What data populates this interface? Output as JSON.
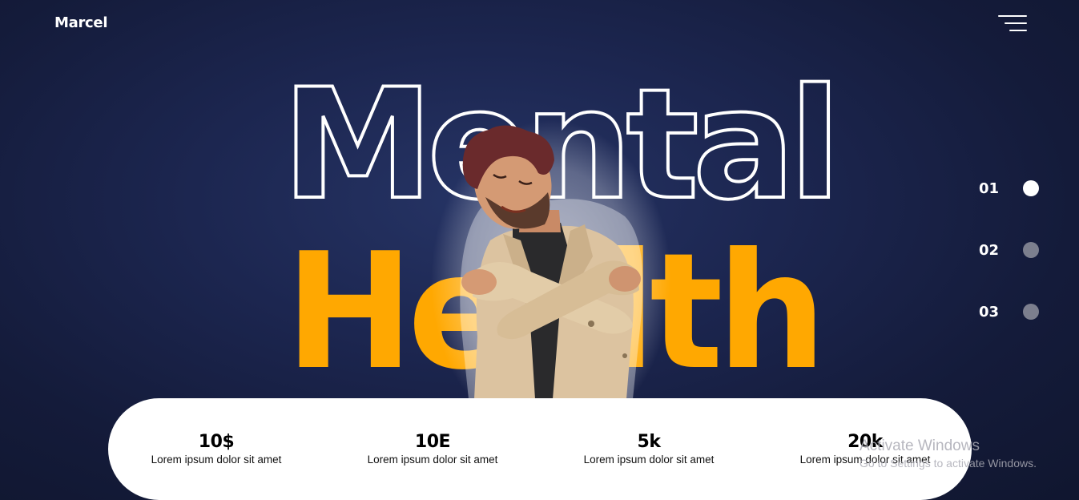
{
  "header": {
    "logo": "Marcel",
    "menu_icon": "hamburger-menu-icon"
  },
  "hero": {
    "title_line1": "Mental",
    "title_line2": "Health",
    "image": "man-hugging-himself-photo"
  },
  "slides": [
    {
      "label": "01",
      "active": true
    },
    {
      "label": "02",
      "active": false
    },
    {
      "label": "03",
      "active": false
    }
  ],
  "stats": [
    {
      "value": "10$",
      "label": "Lorem ipsum dolor sit amet"
    },
    {
      "value": "10E",
      "label": "Lorem ipsum dolor sit amet"
    },
    {
      "value": "5k",
      "label": "Lorem ipsum dolor sit amet"
    },
    {
      "value": "20k",
      "label": "Lorem ipsum dolor sit amet"
    }
  ],
  "watermark": {
    "line1": "Activate Windows",
    "line2": "Go to Settings to activate Windows."
  },
  "colors": {
    "background": "#1c2650",
    "accent": "#ffa801",
    "dot_inactive": "#7c7f8e"
  }
}
